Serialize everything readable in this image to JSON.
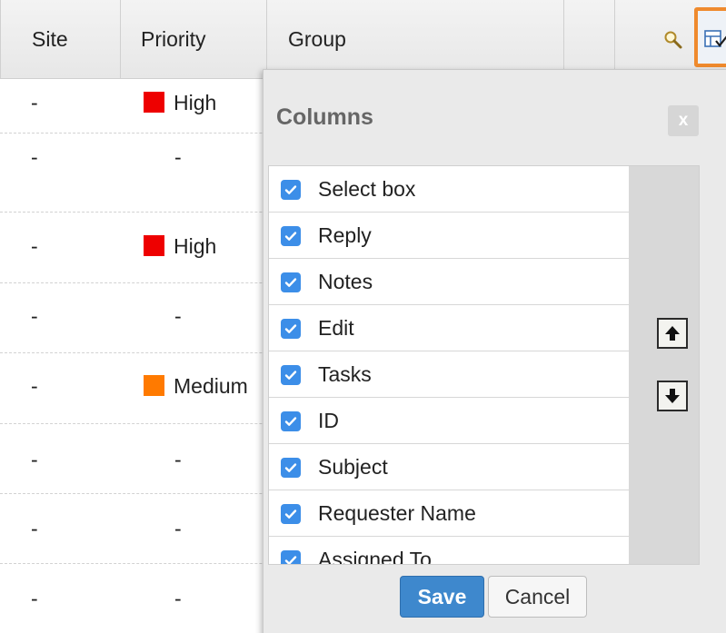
{
  "table": {
    "headers": {
      "site": "Site",
      "priority": "Priority",
      "group": "Group"
    },
    "rows": [
      {
        "site": "-",
        "priority": "High",
        "priority_color": "#ee0000"
      },
      {
        "site": "-",
        "priority": "-"
      },
      {
        "site": "-",
        "priority": "High",
        "priority_color": "#ee0000"
      },
      {
        "site": "-",
        "priority": "-"
      },
      {
        "site": "-",
        "priority": "Medium",
        "priority_color": "#ff7a00"
      },
      {
        "site": "-",
        "priority": "-"
      },
      {
        "site": "-",
        "priority": "-"
      },
      {
        "site": "-",
        "priority": "-"
      }
    ]
  },
  "toolbar": {
    "search_icon": "magnifier-icon",
    "columns_icon": "column-chooser-icon",
    "active_accent": "#ef8a2d"
  },
  "columns_dialog": {
    "title": "Columns",
    "close_label": "x",
    "items": [
      {
        "label": "Select box",
        "checked": true
      },
      {
        "label": "Reply",
        "checked": true
      },
      {
        "label": "Notes",
        "checked": true
      },
      {
        "label": "Edit",
        "checked": true
      },
      {
        "label": "Tasks",
        "checked": true
      },
      {
        "label": "ID",
        "checked": true
      },
      {
        "label": "Subject",
        "checked": true
      },
      {
        "label": "Requester Name",
        "checked": true
      },
      {
        "label": "Assigned To",
        "checked": true
      }
    ],
    "move_up_icon": "arrow-up-icon",
    "move_down_icon": "arrow-down-icon",
    "save_label": "Save",
    "cancel_label": "Cancel"
  },
  "colors": {
    "checkbox": "#3c8ee8",
    "save_button": "#3e88cd",
    "high": "#ee0000",
    "medium": "#ff7a00"
  }
}
